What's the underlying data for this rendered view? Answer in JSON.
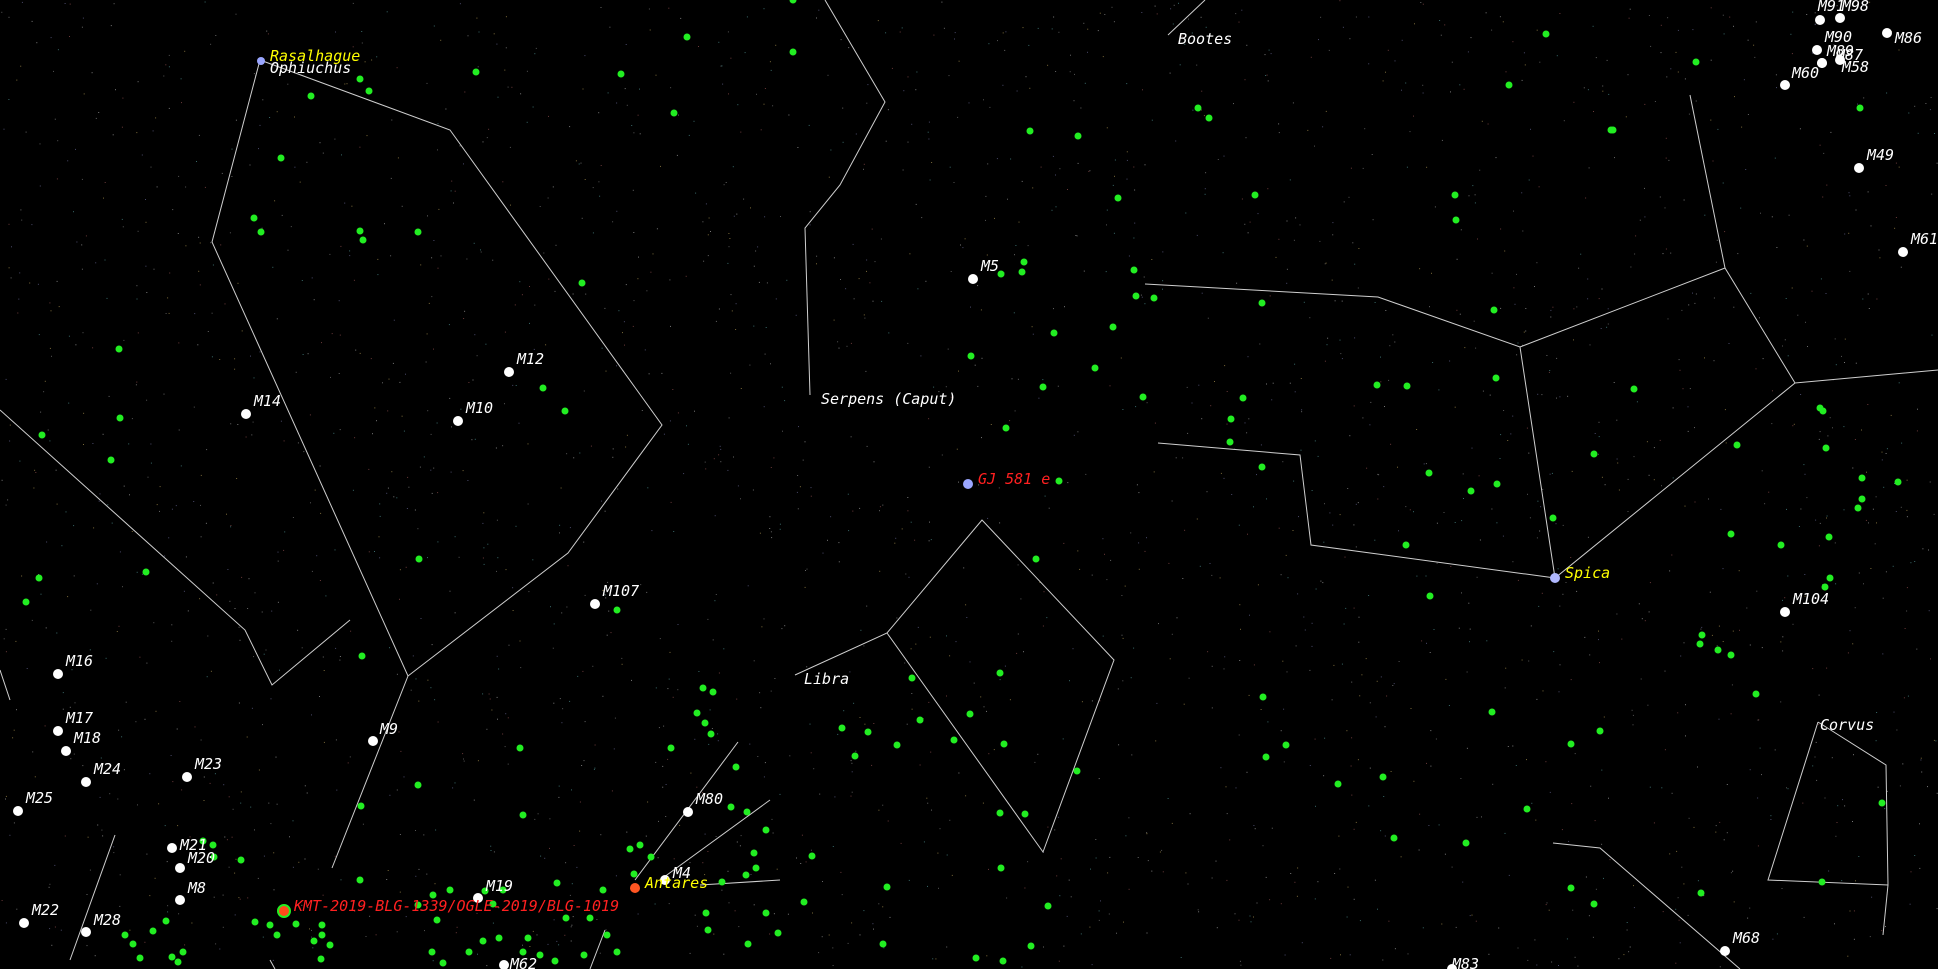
{
  "colors": {
    "background": "#000000",
    "constellation_line": "#cfcfcf",
    "star_label": "#ffff00",
    "messier_label": "#ffffff",
    "constellation_label": "#ffffff",
    "exoplanet_label": "#ff2020",
    "exoplanet_marker": "#9aa6ff",
    "galaxy_dot": "#22ee22",
    "messier_dot": "#ffffff"
  },
  "constellations": [
    "Ophiuchus",
    "Bootes",
    "Serpens (Caput)",
    "Libra",
    "Corvus"
  ],
  "stars": [
    "Rasalhague",
    "Spica",
    "Antares"
  ],
  "messier": [
    "M12",
    "M10",
    "M14",
    "M5",
    "M107",
    "M9",
    "M16",
    "M17",
    "M18",
    "M24",
    "M23",
    "M25",
    "M21",
    "M20",
    "M8",
    "M22",
    "M28",
    "M19",
    "M80",
    "M4",
    "M62",
    "M83",
    "M68",
    "M104",
    "M49",
    "M61",
    "M90",
    "M89",
    "M87",
    "M86",
    "M60",
    "M58",
    "M91",
    "M98"
  ],
  "exoplanets": [
    "GJ 581 e",
    "KMT-2019-BLG-1339/OGLE-2019/BLG-1019"
  ]
}
